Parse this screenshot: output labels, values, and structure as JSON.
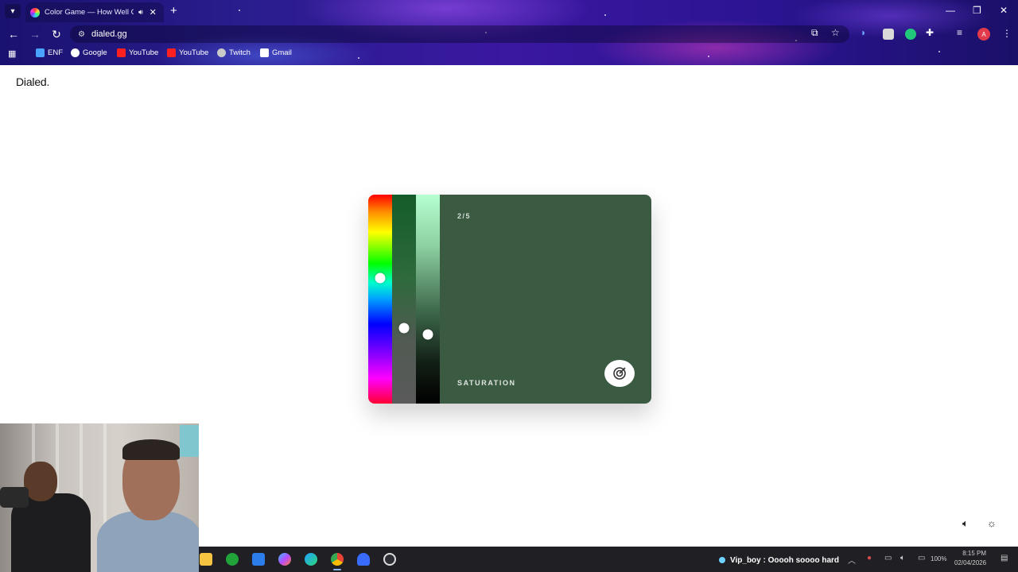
{
  "browser": {
    "tab_title": "Color Game — How Well C",
    "tab_audio_icon": "speaker-icon",
    "url": "dialed.gg",
    "bookmarks": [
      {
        "label": "ENF",
        "icon": "enf-icon",
        "color": "#4aa3ff"
      },
      {
        "label": "Google",
        "icon": "google-icon",
        "color": "#ffffff"
      },
      {
        "label": "YouTube",
        "icon": "youtube-icon",
        "color": "#ff2020"
      },
      {
        "label": "YouTube",
        "icon": "youtube-icon",
        "color": "#ff2020"
      },
      {
        "label": "Twitch",
        "icon": "globe-icon",
        "color": "#c9c9c9"
      },
      {
        "label": "Gmail",
        "icon": "gmail-icon",
        "color": "#ffffff"
      }
    ],
    "profile_initial": "A"
  },
  "site": {
    "logo": "Dialed."
  },
  "game": {
    "round": "2/5",
    "active_control": "SATURATION",
    "target_color": "#3b5a42",
    "hue_level": 0.4,
    "saturation_level": 0.64,
    "brightness_level": 0.67
  },
  "stream": {
    "chat_message": "Vip_boy : Ooooh soooo hard"
  },
  "taskbar": {
    "battery": "100%",
    "time": "8:15 PM",
    "date": "02/04/2026"
  }
}
